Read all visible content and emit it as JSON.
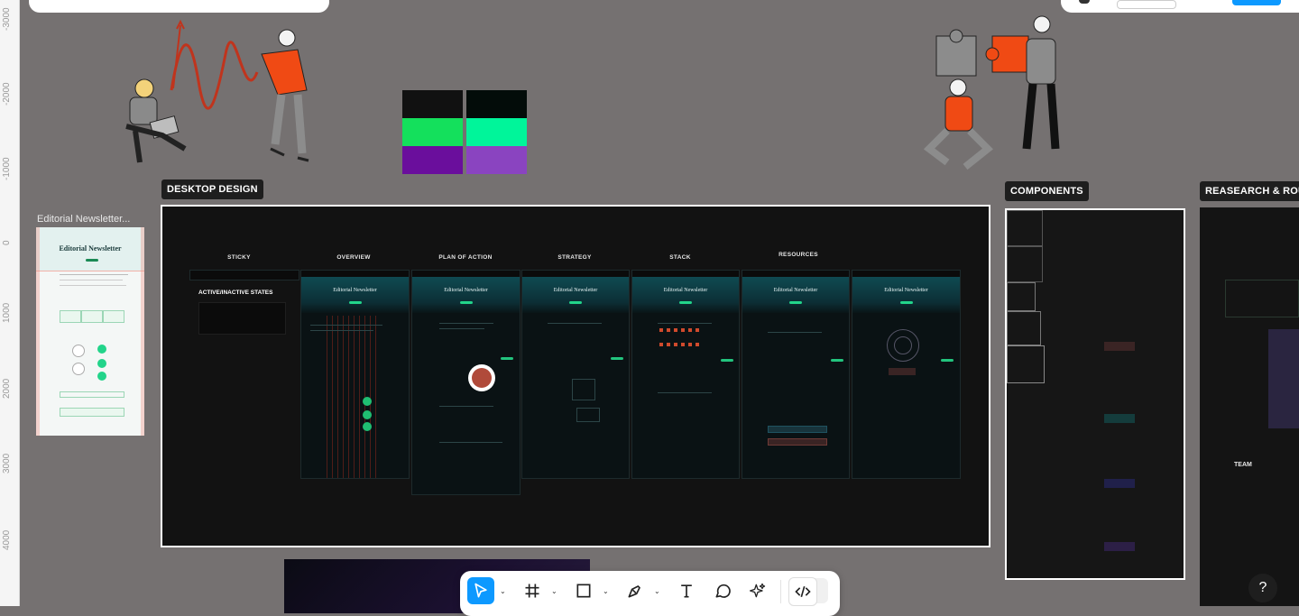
{
  "ruler": {
    "labels": [
      "-3000",
      "-2000",
      "-1000",
      "0",
      "1000",
      "2000",
      "3000",
      "4000"
    ]
  },
  "labels": {
    "desktop_design": "DESKTOP DESIGN",
    "components": "COMPONENTS",
    "research": "REASEARCH & ROU",
    "editorial_frame": "Editorial Newsletter...",
    "team": "TEAM"
  },
  "desktop": {
    "columns": [
      "STICKY",
      "OVERVIEW",
      "PLAN OF ACTION",
      "STRATEGY",
      "STACK",
      "RESOURCES"
    ],
    "sticky_heading": "ACTIVE/INACTIVE STATES",
    "screen_title": "Editorial Newsletter"
  },
  "editorial": {
    "title": "Editorial Newsletter"
  },
  "colors": {
    "canvas": "#757171",
    "accent": "#0d99ff",
    "brand_green": "#22d48a",
    "swatches": [
      "#111111",
      "#030c09",
      "#14e05c",
      "#00f59a",
      "#6a0e9c",
      "#8a44c0"
    ]
  },
  "toolbar": {
    "tools": [
      "move-tool",
      "frame-tool",
      "shape-tool",
      "pen-tool",
      "text-tool",
      "comment-tool",
      "actions-tool",
      "dev-mode-toggle"
    ],
    "help_label": "?"
  }
}
